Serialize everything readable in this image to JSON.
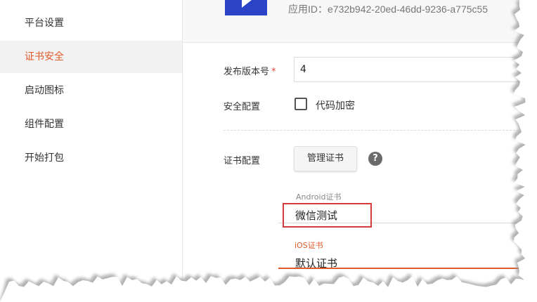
{
  "sidebar": {
    "items": [
      {
        "label": "平台设置"
      },
      {
        "label": "证书安全",
        "active": true
      },
      {
        "label": "启动图标"
      },
      {
        "label": "组件配置"
      },
      {
        "label": "开始打包"
      }
    ]
  },
  "header": {
    "app_id": "应用ID：e732b942-20ed-46dd-9236-a775c55"
  },
  "form": {
    "version_label": "发布版本号",
    "required_mark": "*",
    "version_value": "4",
    "security_label": "安全配置",
    "code_encrypt_label": "代码加密",
    "code_encrypt_checked": false,
    "cert_label": "证书配置",
    "manage_cert_button": "管理证书",
    "help_icon_glyph": "?",
    "android_cert_caption": "Android证书",
    "android_cert_value": "微信测试",
    "ios_cert_caption": "iOS证书",
    "ios_cert_value": "默认证书"
  },
  "colors": {
    "accent": "#e05a2a",
    "highlight_box": "#d63a3a",
    "logo_blue": "#2b43c6"
  }
}
